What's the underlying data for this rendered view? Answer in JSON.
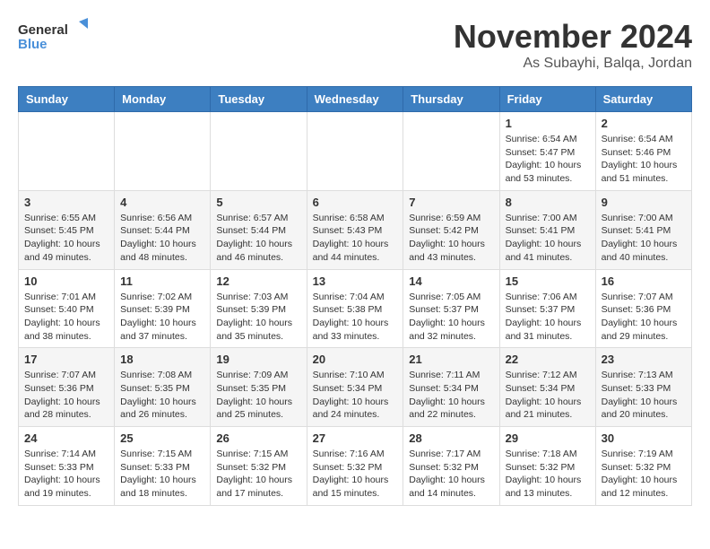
{
  "header": {
    "logo_line1": "General",
    "logo_line2": "Blue",
    "month": "November 2024",
    "location": "As Subayhi, Balqa, Jordan"
  },
  "weekdays": [
    "Sunday",
    "Monday",
    "Tuesday",
    "Wednesday",
    "Thursday",
    "Friday",
    "Saturday"
  ],
  "weeks": [
    [
      {
        "day": "",
        "info": ""
      },
      {
        "day": "",
        "info": ""
      },
      {
        "day": "",
        "info": ""
      },
      {
        "day": "",
        "info": ""
      },
      {
        "day": "",
        "info": ""
      },
      {
        "day": "1",
        "info": "Sunrise: 6:54 AM\nSunset: 5:47 PM\nDaylight: 10 hours\nand 53 minutes."
      },
      {
        "day": "2",
        "info": "Sunrise: 6:54 AM\nSunset: 5:46 PM\nDaylight: 10 hours\nand 51 minutes."
      }
    ],
    [
      {
        "day": "3",
        "info": "Sunrise: 6:55 AM\nSunset: 5:45 PM\nDaylight: 10 hours\nand 49 minutes."
      },
      {
        "day": "4",
        "info": "Sunrise: 6:56 AM\nSunset: 5:44 PM\nDaylight: 10 hours\nand 48 minutes."
      },
      {
        "day": "5",
        "info": "Sunrise: 6:57 AM\nSunset: 5:44 PM\nDaylight: 10 hours\nand 46 minutes."
      },
      {
        "day": "6",
        "info": "Sunrise: 6:58 AM\nSunset: 5:43 PM\nDaylight: 10 hours\nand 44 minutes."
      },
      {
        "day": "7",
        "info": "Sunrise: 6:59 AM\nSunset: 5:42 PM\nDaylight: 10 hours\nand 43 minutes."
      },
      {
        "day": "8",
        "info": "Sunrise: 7:00 AM\nSunset: 5:41 PM\nDaylight: 10 hours\nand 41 minutes."
      },
      {
        "day": "9",
        "info": "Sunrise: 7:00 AM\nSunset: 5:41 PM\nDaylight: 10 hours\nand 40 minutes."
      }
    ],
    [
      {
        "day": "10",
        "info": "Sunrise: 7:01 AM\nSunset: 5:40 PM\nDaylight: 10 hours\nand 38 minutes."
      },
      {
        "day": "11",
        "info": "Sunrise: 7:02 AM\nSunset: 5:39 PM\nDaylight: 10 hours\nand 37 minutes."
      },
      {
        "day": "12",
        "info": "Sunrise: 7:03 AM\nSunset: 5:39 PM\nDaylight: 10 hours\nand 35 minutes."
      },
      {
        "day": "13",
        "info": "Sunrise: 7:04 AM\nSunset: 5:38 PM\nDaylight: 10 hours\nand 33 minutes."
      },
      {
        "day": "14",
        "info": "Sunrise: 7:05 AM\nSunset: 5:37 PM\nDaylight: 10 hours\nand 32 minutes."
      },
      {
        "day": "15",
        "info": "Sunrise: 7:06 AM\nSunset: 5:37 PM\nDaylight: 10 hours\nand 31 minutes."
      },
      {
        "day": "16",
        "info": "Sunrise: 7:07 AM\nSunset: 5:36 PM\nDaylight: 10 hours\nand 29 minutes."
      }
    ],
    [
      {
        "day": "17",
        "info": "Sunrise: 7:07 AM\nSunset: 5:36 PM\nDaylight: 10 hours\nand 28 minutes."
      },
      {
        "day": "18",
        "info": "Sunrise: 7:08 AM\nSunset: 5:35 PM\nDaylight: 10 hours\nand 26 minutes."
      },
      {
        "day": "19",
        "info": "Sunrise: 7:09 AM\nSunset: 5:35 PM\nDaylight: 10 hours\nand 25 minutes."
      },
      {
        "day": "20",
        "info": "Sunrise: 7:10 AM\nSunset: 5:34 PM\nDaylight: 10 hours\nand 24 minutes."
      },
      {
        "day": "21",
        "info": "Sunrise: 7:11 AM\nSunset: 5:34 PM\nDaylight: 10 hours\nand 22 minutes."
      },
      {
        "day": "22",
        "info": "Sunrise: 7:12 AM\nSunset: 5:34 PM\nDaylight: 10 hours\nand 21 minutes."
      },
      {
        "day": "23",
        "info": "Sunrise: 7:13 AM\nSunset: 5:33 PM\nDaylight: 10 hours\nand 20 minutes."
      }
    ],
    [
      {
        "day": "24",
        "info": "Sunrise: 7:14 AM\nSunset: 5:33 PM\nDaylight: 10 hours\nand 19 minutes."
      },
      {
        "day": "25",
        "info": "Sunrise: 7:15 AM\nSunset: 5:33 PM\nDaylight: 10 hours\nand 18 minutes."
      },
      {
        "day": "26",
        "info": "Sunrise: 7:15 AM\nSunset: 5:32 PM\nDaylight: 10 hours\nand 17 minutes."
      },
      {
        "day": "27",
        "info": "Sunrise: 7:16 AM\nSunset: 5:32 PM\nDaylight: 10 hours\nand 15 minutes."
      },
      {
        "day": "28",
        "info": "Sunrise: 7:17 AM\nSunset: 5:32 PM\nDaylight: 10 hours\nand 14 minutes."
      },
      {
        "day": "29",
        "info": "Sunrise: 7:18 AM\nSunset: 5:32 PM\nDaylight: 10 hours\nand 13 minutes."
      },
      {
        "day": "30",
        "info": "Sunrise: 7:19 AM\nSunset: 5:32 PM\nDaylight: 10 hours\nand 12 minutes."
      }
    ]
  ]
}
